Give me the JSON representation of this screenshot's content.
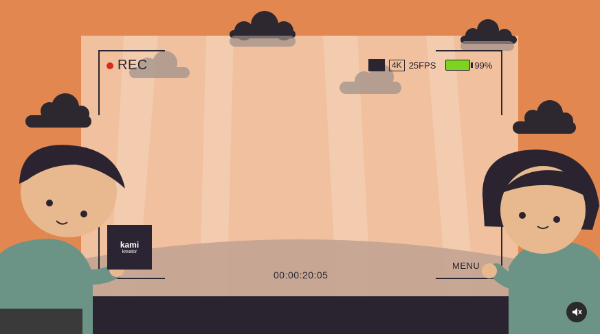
{
  "viewfinder": {
    "rec_label": "REC",
    "resolution": "4K",
    "fps": "25FPS",
    "battery": "99%",
    "timecode": "00:00:20:05",
    "menu_label": "MENU"
  },
  "logo": {
    "line1": "kami",
    "line2": "kreator"
  },
  "controls": {
    "mute_icon": "speaker-muted-icon"
  },
  "colors": {
    "background": "#e2874f",
    "dark": "#2a2530",
    "rec_red": "#d92a1c",
    "battery_green": "#7ed321",
    "shirt": "#6b9486",
    "skin": "#e8b98e"
  }
}
